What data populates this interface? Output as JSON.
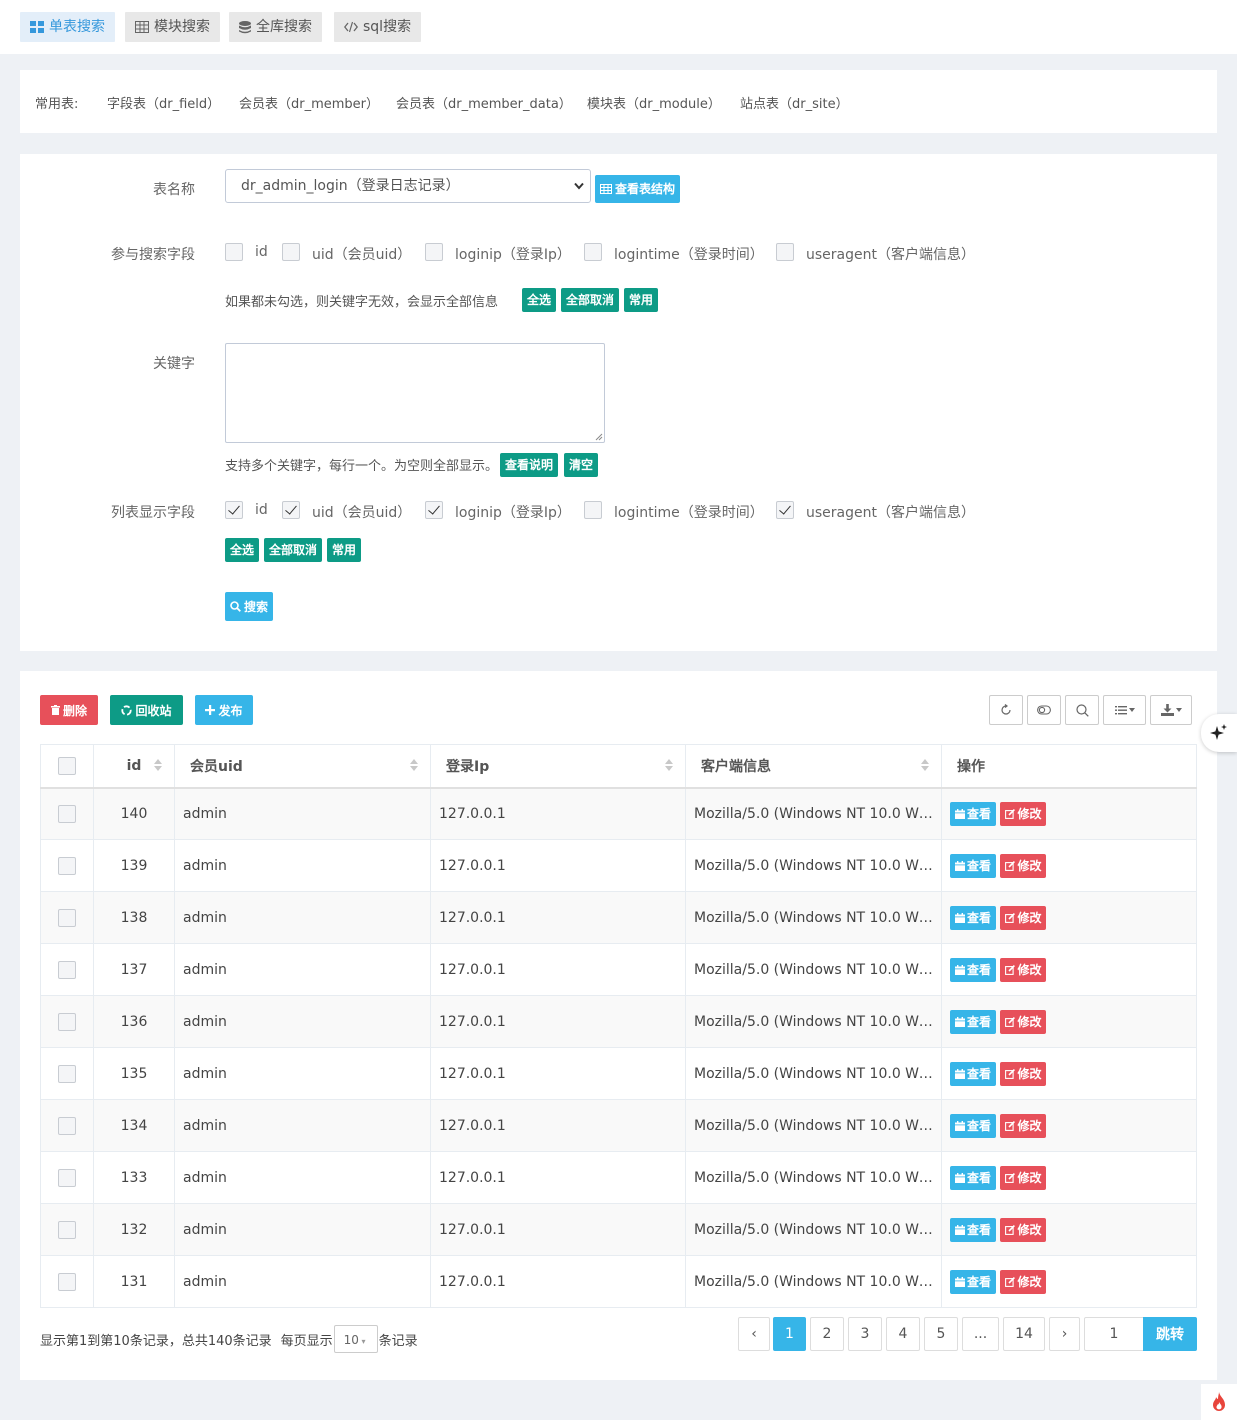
{
  "tabs": [
    {
      "label": "单表搜索",
      "icon": "grid-icon",
      "active": true
    },
    {
      "label": "模块搜索",
      "icon": "table-icon",
      "active": false
    },
    {
      "label": "全库搜索",
      "icon": "database-icon",
      "active": false
    },
    {
      "label": "sql搜索",
      "icon": "code-icon",
      "active": false
    }
  ],
  "common": {
    "label": "常用表:",
    "items": [
      "字段表（dr_field）",
      "会员表（dr_member）",
      "会员表（dr_member_data）",
      "模块表（dr_module）",
      "站点表（dr_site）"
    ]
  },
  "form": {
    "table_label": "表名称",
    "table_value": "dr_admin_login（登录日志记录）",
    "view_struct": "查看表结构",
    "search_fields_label": "参与搜索字段",
    "fields": [
      "id",
      "uid（会员uid）",
      "loginip（登录Ip）",
      "logintime（登录时间）",
      "useragent（客户端信息）"
    ],
    "search_hint": "如果都未勾选，则关键字无效，会显示全部信息",
    "select_all": "全选",
    "deselect_all": "全部取消",
    "common_btn": "常用",
    "keyword_label": "关键字",
    "keyword_hint": "支持多个关键字，每行一个。为空则全部显示。",
    "view_desc": "查看说明",
    "clear": "清空",
    "list_fields_label": "列表显示字段",
    "search_btn": "搜索"
  },
  "toolbar": {
    "delete": "删除",
    "recycle": "回收站",
    "publish": "发布"
  },
  "table": {
    "headers": [
      "id",
      "会员uid",
      "登录Ip",
      "客户端信息",
      "操作"
    ],
    "rows": [
      {
        "id": "140",
        "uid": "admin",
        "ip": "127.0.0.1",
        "ua": "Mozilla/5.0 (Windows NT 10.0 Win…"
      },
      {
        "id": "139",
        "uid": "admin",
        "ip": "127.0.0.1",
        "ua": "Mozilla/5.0 (Windows NT 10.0 Win…"
      },
      {
        "id": "138",
        "uid": "admin",
        "ip": "127.0.0.1",
        "ua": "Mozilla/5.0 (Windows NT 10.0 Win…"
      },
      {
        "id": "137",
        "uid": "admin",
        "ip": "127.0.0.1",
        "ua": "Mozilla/5.0 (Windows NT 10.0 Win…"
      },
      {
        "id": "136",
        "uid": "admin",
        "ip": "127.0.0.1",
        "ua": "Mozilla/5.0 (Windows NT 10.0 Win…"
      },
      {
        "id": "135",
        "uid": "admin",
        "ip": "127.0.0.1",
        "ua": "Mozilla/5.0 (Windows NT 10.0 Win…"
      },
      {
        "id": "134",
        "uid": "admin",
        "ip": "127.0.0.1",
        "ua": "Mozilla/5.0 (Windows NT 10.0 Win…"
      },
      {
        "id": "133",
        "uid": "admin",
        "ip": "127.0.0.1",
        "ua": "Mozilla/5.0 (Windows NT 10.0 Win…"
      },
      {
        "id": "132",
        "uid": "admin",
        "ip": "127.0.0.1",
        "ua": "Mozilla/5.0 (Windows NT 10.0 Win…"
      },
      {
        "id": "131",
        "uid": "admin",
        "ip": "127.0.0.1",
        "ua": "Mozilla/5.0 (Windows NT 10.0 Win…"
      }
    ],
    "view_btn": "查看",
    "edit_btn": "修改"
  },
  "footer": {
    "summary": "显示第1到第10条记录，总共140条记录",
    "per_page_prefix": "每页显示",
    "per_page_value": "10",
    "per_page_suffix": "条记录"
  },
  "pagination": {
    "prev": "‹",
    "pages": [
      "1",
      "2",
      "3",
      "4",
      "5",
      "...",
      "14"
    ],
    "next": "›",
    "jump_value": "1",
    "jump_btn": "跳转"
  },
  "colors": {
    "blue": "#36b5e8",
    "green": "#0d9b86",
    "red": "#e7505a",
    "tab_active": "#3598dc"
  }
}
